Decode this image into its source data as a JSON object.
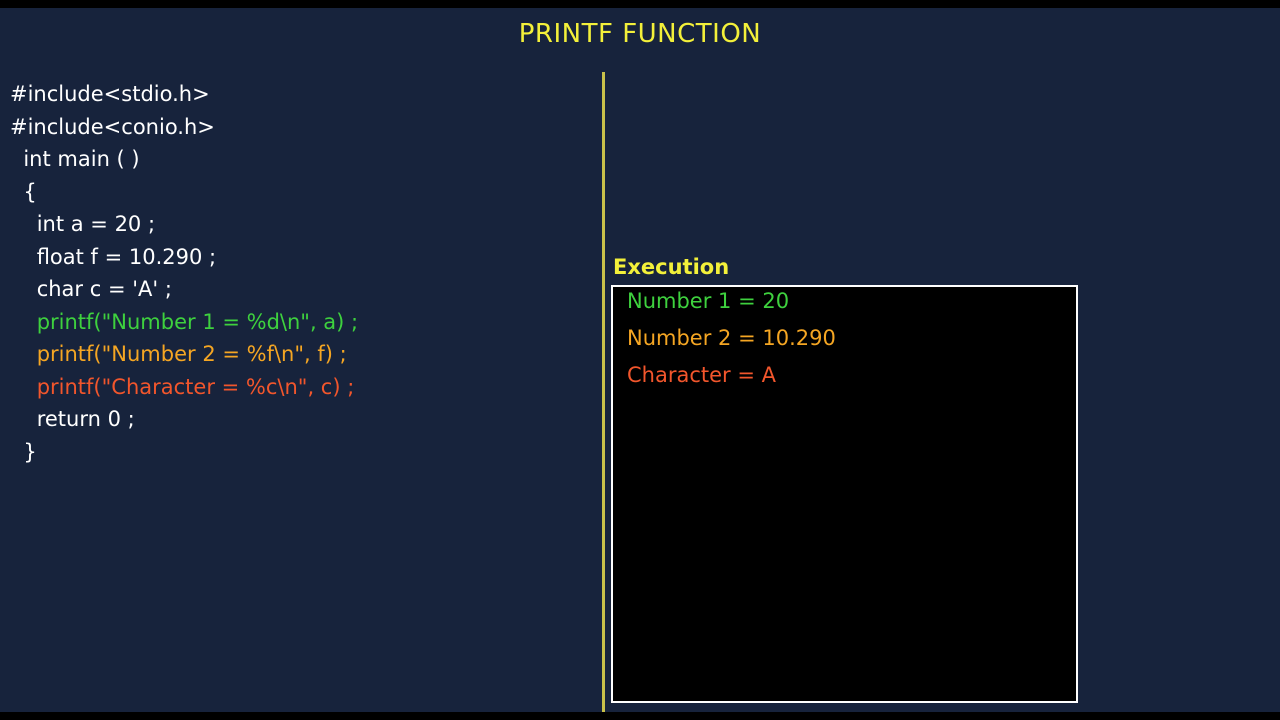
{
  "title": "PRINTF FUNCTION",
  "colors": {
    "background": "#17233c",
    "title": "#f3f03a",
    "code_default": "#ffffff",
    "green": "#3ed13e",
    "orange": "#f5a623",
    "red": "#f2562c",
    "divider": "#c9c14a"
  },
  "code": [
    {
      "text": "#include<stdio.h>",
      "color": "#ffffff"
    },
    {
      "text": "#include<conio.h>",
      "color": "#ffffff"
    },
    {
      "text": "  int main ( )",
      "color": "#ffffff"
    },
    {
      "text": "  {",
      "color": "#ffffff"
    },
    {
      "text": "    int a = 20 ;",
      "color": "#ffffff"
    },
    {
      "text": "    float f = 10.290 ;",
      "color": "#ffffff"
    },
    {
      "text": "    char c = 'A' ;",
      "color": "#ffffff"
    },
    {
      "text": "    printf(\"Number 1 = %d\\n\", a) ;",
      "color": "#3ed13e"
    },
    {
      "text": "    printf(\"Number 2 = %f\\n\", f) ;",
      "color": "#f5a623"
    },
    {
      "text": "    printf(\"Character = %c\\n\", c) ;",
      "color": "#f2562c"
    },
    {
      "text": "    return 0 ;",
      "color": "#ffffff"
    },
    {
      "text": "  }",
      "color": "#ffffff"
    }
  ],
  "execution": {
    "label": "Execution",
    "output": [
      {
        "text": "Number 1 = 20",
        "color": "#3ed13e"
      },
      {
        "text": "Number 2 = 10.290",
        "color": "#f5a623"
      },
      {
        "text": "Character = A",
        "color": "#f2562c"
      }
    ]
  }
}
